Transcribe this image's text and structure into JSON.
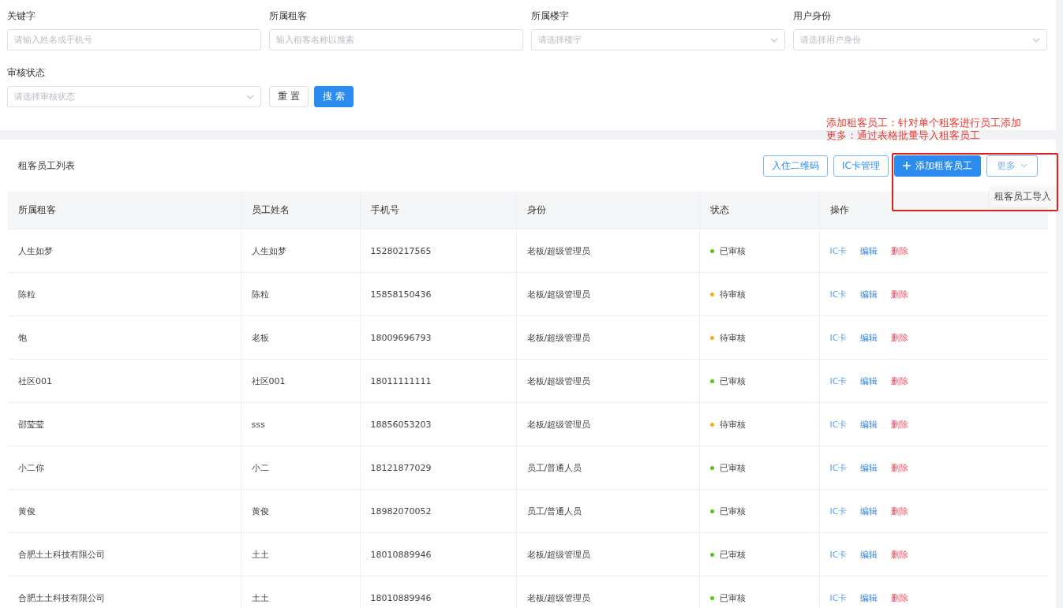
{
  "filters": [
    {
      "label": "关键字",
      "kind": "input",
      "placeholder": "请输入姓名或手机号"
    },
    {
      "label": "所属租客",
      "kind": "input",
      "placeholder": "输入租客名称以搜索"
    },
    {
      "label": "所属楼宇",
      "kind": "select",
      "placeholder": "请选择楼宇"
    },
    {
      "label": "用户身份",
      "kind": "select",
      "placeholder": "请选择用户身份"
    },
    {
      "label": "审核状态",
      "kind": "select",
      "placeholder": "请选择审核状态"
    }
  ],
  "filter_buttons": [
    {
      "label": "重 置",
      "kind": "default"
    },
    {
      "label": "搜 索",
      "kind": "primary"
    }
  ],
  "annotation": [
    "添加租客员工：针对单个租客进行员工添加",
    "更多：通过表格批量导入租客员工"
  ],
  "table_title": "租客员工列表",
  "toolbar": [
    {
      "label": "入住二维码",
      "kind": "outline"
    },
    {
      "label": "IC卡管理",
      "kind": "outline"
    },
    {
      "label": "添加租客员工",
      "kind": "primary"
    },
    {
      "label": "更多",
      "kind": "dropdown"
    }
  ],
  "dropdown_menu": [
    "租客员工导入"
  ],
  "table": {
    "columns": [
      "所属租客",
      "员工姓名",
      "手机号",
      "身份",
      "状态",
      "操作"
    ],
    "rows": [
      {
        "tenant": "人生如梦",
        "name": "人生如梦",
        "phone": "15280217565",
        "role": "老板/超级管理员",
        "status": "已审核",
        "color": "#52c41a",
        "actions": [
          "IC卡",
          "编辑",
          "删除"
        ]
      },
      {
        "tenant": "陈粒",
        "name": "陈粒",
        "phone": "15858150436",
        "role": "老板/超级管理员",
        "status": "待审核",
        "color": "#faad14",
        "actions": [
          "IC卡",
          "编辑",
          "删除"
        ]
      },
      {
        "tenant": "饱",
        "name": "老板",
        "phone": "18009696793",
        "role": "老板/超级管理员",
        "status": "待审核",
        "color": "#faad14",
        "actions": [
          "IC卡",
          "编辑",
          "删除"
        ]
      },
      {
        "tenant": "社区001",
        "name": "社区001",
        "phone": "18011111111",
        "role": "老板/超级管理员",
        "status": "已审核",
        "color": "#52c41a",
        "actions": [
          "IC卡",
          "编辑",
          "删除"
        ]
      },
      {
        "tenant": "邵莹莹",
        "name": "sss",
        "phone": "18856053203",
        "role": "老板/超级管理员",
        "status": "待审核",
        "color": "#faad14",
        "actions": [
          "IC卡",
          "编辑",
          "删除"
        ]
      },
      {
        "tenant": "小二你",
        "name": "小二",
        "phone": "18121877029",
        "role": "员工/普通人员",
        "status": "已审核",
        "color": "#52c41a",
        "actions": [
          "IC卡",
          "编辑",
          "删除"
        ]
      },
      {
        "tenant": "黄俊",
        "name": "黄俊",
        "phone": "18982070052",
        "role": "员工/普通人员",
        "status": "已审核",
        "color": "#52c41a",
        "actions": [
          "IC卡",
          "编辑",
          "删除"
        ]
      },
      {
        "tenant": "合肥土土科技有限公司",
        "name": "土土",
        "phone": "18010889946",
        "role": "老板/超级管理员",
        "status": "已审核",
        "color": "#52c41a",
        "actions": [
          "IC卡",
          "编辑",
          "删除"
        ]
      },
      {
        "tenant": "合肥土土科技有限公司",
        "name": "土土",
        "phone": "18010889946",
        "role": "老板/超级管理员",
        "status": "已审核",
        "color": "#52c41a",
        "actions": [
          "IC卡",
          "编辑",
          "删除"
        ]
      }
    ]
  }
}
